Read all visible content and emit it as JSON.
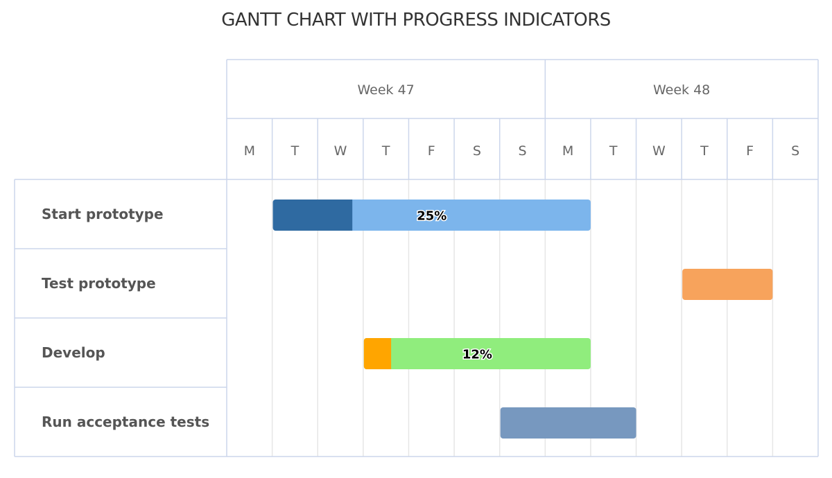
{
  "chart_data": {
    "type": "gantt",
    "title": "GANTT CHART WITH PROGRESS INDICATORS",
    "weeks": [
      {
        "label": "Week 47",
        "days": 7
      },
      {
        "label": "Week 48",
        "days": 6
      }
    ],
    "day_labels": [
      "M",
      "T",
      "W",
      "T",
      "F",
      "S",
      "S",
      "M",
      "T",
      "W",
      "T",
      "F",
      "S"
    ],
    "tasks": [
      {
        "name": "Start prototype",
        "start_day": 1.0,
        "end_day": 8.0,
        "progress": 0.25,
        "progress_label": "25%",
        "color": "#7cb5ec",
        "progress_color": "#2f6aa1"
      },
      {
        "name": "Test prototype",
        "start_day": 10.0,
        "end_day": 12.0,
        "progress": null,
        "progress_label": "",
        "color": "#f7a35c",
        "progress_color": ""
      },
      {
        "name": "Develop",
        "start_day": 3.0,
        "end_day": 8.0,
        "progress": 0.12,
        "progress_label": "12%",
        "color": "#90ed7d",
        "progress_color": "#ffa500"
      },
      {
        "name": "Run acceptance tests",
        "start_day": 6.0,
        "end_day": 9.0,
        "progress": null,
        "progress_label": "",
        "color": "#7798bf",
        "progress_color": ""
      }
    ]
  }
}
